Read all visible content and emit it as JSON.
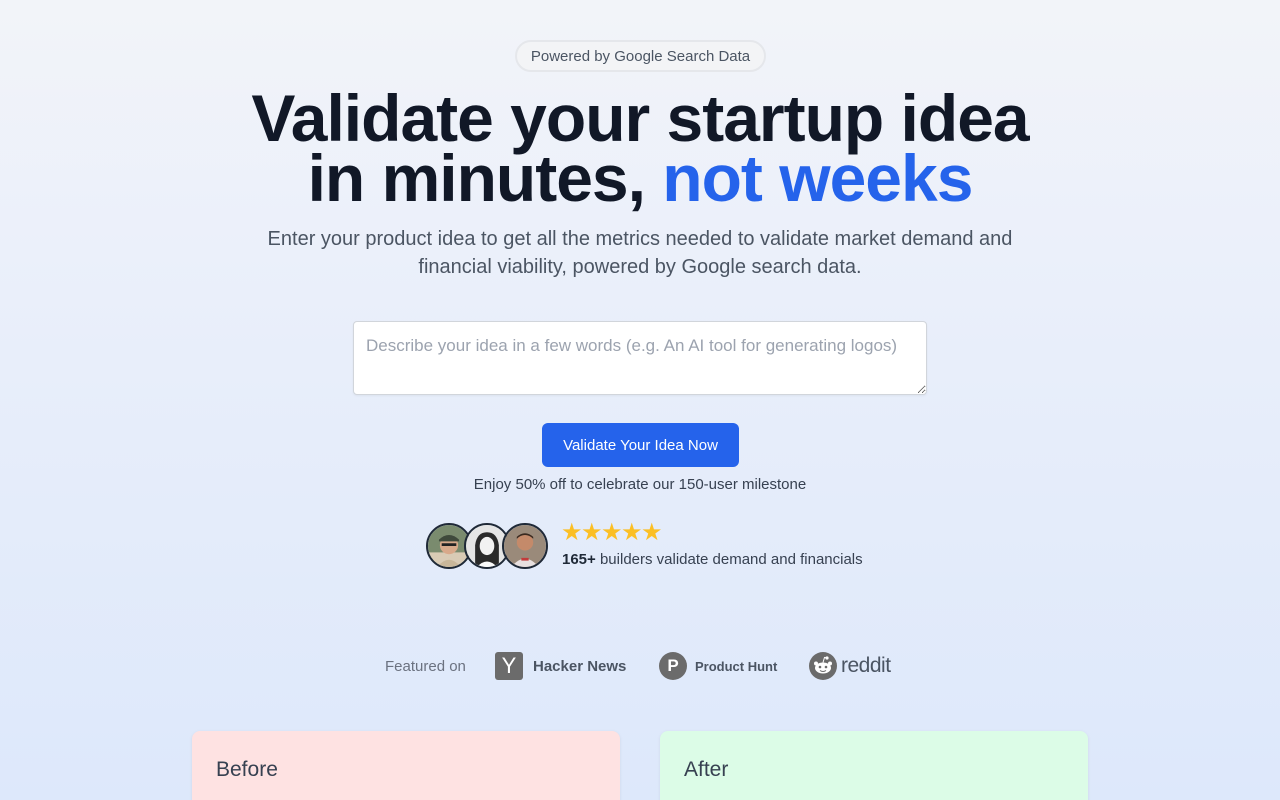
{
  "badge": "Powered by Google Search Data",
  "headline": {
    "line1": "Validate your startup idea",
    "line2_prefix": "in minutes, ",
    "line2_accent": "not weeks"
  },
  "subtitle": "Enter your product idea to get all the metrics needed to validate market demand and financial viability, powered by Google search data.",
  "idea_input": {
    "placeholder": "Describe your idea in a few words (e.g. An AI tool for generating logos)",
    "value": ""
  },
  "cta_label": "Validate Your Idea Now",
  "promo": "Enjoy 50% off to celebrate our 150-user milestone",
  "social_proof": {
    "rating": 5,
    "count": "165+",
    "text": " builders validate demand and financials"
  },
  "featured": {
    "label": "Featured on",
    "hn_letter": "Y",
    "hn": "Hacker News",
    "ph_letter": "P",
    "ph": "Product Hunt",
    "reddit": "reddit"
  },
  "cards": {
    "before": "Before",
    "after": "After"
  },
  "colors": {
    "accent": "#2563eb",
    "star": "#fbbf24",
    "before_bg": "#fee2e2",
    "after_bg": "#dcfce7"
  }
}
